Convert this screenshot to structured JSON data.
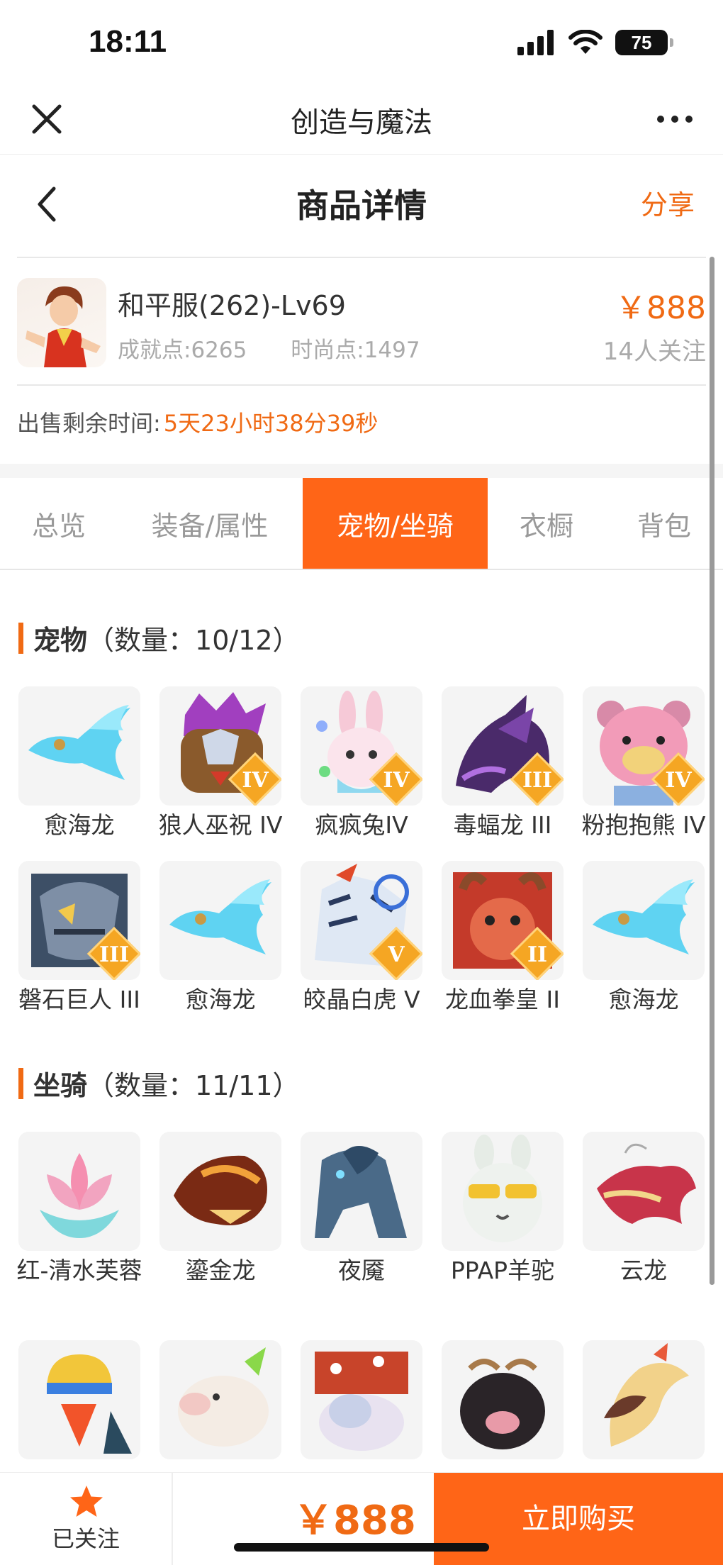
{
  "status": {
    "time": "18:11",
    "battery": "75"
  },
  "app_bar": {
    "title": "创造与魔法"
  },
  "header": {
    "title": "商品详情",
    "share": "分享"
  },
  "product": {
    "name": "和平服(262)-Lv69",
    "achievement": "成就点:6265",
    "fashion": "时尚点:1497",
    "price": "￥888",
    "watchers": "14人关注"
  },
  "remain": {
    "label": "出售剩余时间:",
    "time": "5天23小时38分39秒"
  },
  "tabs": [
    "总览",
    "装备/属性",
    "宠物/坐骑",
    "衣橱",
    "背包"
  ],
  "pets": {
    "name": "宠物",
    "count": "（数量：10/12）",
    "items": [
      {
        "label": "愈海龙",
        "rank": ""
      },
      {
        "label": "狼人巫祝 IV",
        "rank": "IV"
      },
      {
        "label": "疯疯兔IV",
        "rank": "IV"
      },
      {
        "label": "毒蝠龙 III",
        "rank": "III"
      },
      {
        "label": "粉抱抱熊 IV",
        "rank": "IV"
      },
      {
        "label": "磐石巨人 III",
        "rank": "III"
      },
      {
        "label": "愈海龙",
        "rank": ""
      },
      {
        "label": "皎晶白虎 V",
        "rank": "V"
      },
      {
        "label": "龙血拳皇 II",
        "rank": "II"
      },
      {
        "label": "愈海龙",
        "rank": ""
      }
    ]
  },
  "mounts": {
    "name": "坐骑",
    "count": "（数量：11/11）",
    "items": [
      {
        "label": "红-清水芙蓉"
      },
      {
        "label": "鎏金龙"
      },
      {
        "label": "夜魇"
      },
      {
        "label": "PPAP羊驼"
      },
      {
        "label": "云龙"
      },
      {
        "label": ""
      },
      {
        "label": ""
      },
      {
        "label": ""
      },
      {
        "label": ""
      },
      {
        "label": ""
      }
    ]
  },
  "bottom": {
    "follow": "已关注",
    "price": "￥888",
    "buy": "立即购买"
  },
  "colors": {
    "accent": "#ff6517",
    "price": "#f06a14"
  }
}
